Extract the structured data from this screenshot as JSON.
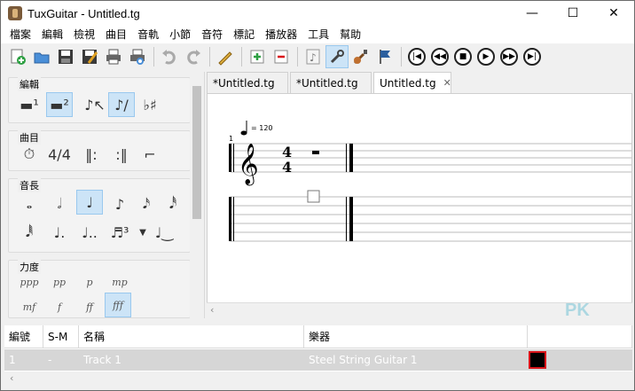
{
  "window": {
    "title": "TuxGuitar - Untitled.tg",
    "minimize": "—",
    "maximize": "☐",
    "close": "✕"
  },
  "menu": [
    "檔案",
    "編輯",
    "檢視",
    "曲目",
    "音軌",
    "小節",
    "音符",
    "標記",
    "播放器",
    "工具",
    "幫助"
  ],
  "palette": {
    "groups": [
      {
        "title": "編輯"
      },
      {
        "title": "曲目"
      },
      {
        "title": "音長"
      },
      {
        "title": "力度"
      }
    ],
    "dynamics": [
      "ppp",
      "pp",
      "p",
      "mp",
      "mf",
      "f",
      "ff",
      "fff"
    ]
  },
  "tabs": [
    {
      "label": "*Untitled.tg",
      "active": false
    },
    {
      "label": "*Untitled.tg",
      "active": false
    },
    {
      "label": "Untitled.tg",
      "active": true
    }
  ],
  "score": {
    "tempo": "= 120",
    "measure_number": "1",
    "time_sig_top": "4",
    "time_sig_bottom": "4"
  },
  "track_table": {
    "headers": [
      "編號",
      "S-M",
      "名稱",
      "樂器"
    ],
    "rows": [
      {
        "number": "1",
        "sm": "-",
        "name": "Track 1",
        "instrument": "Steel String Guitar 1",
        "color": "#000000"
      }
    ]
  },
  "watermark": "PK"
}
